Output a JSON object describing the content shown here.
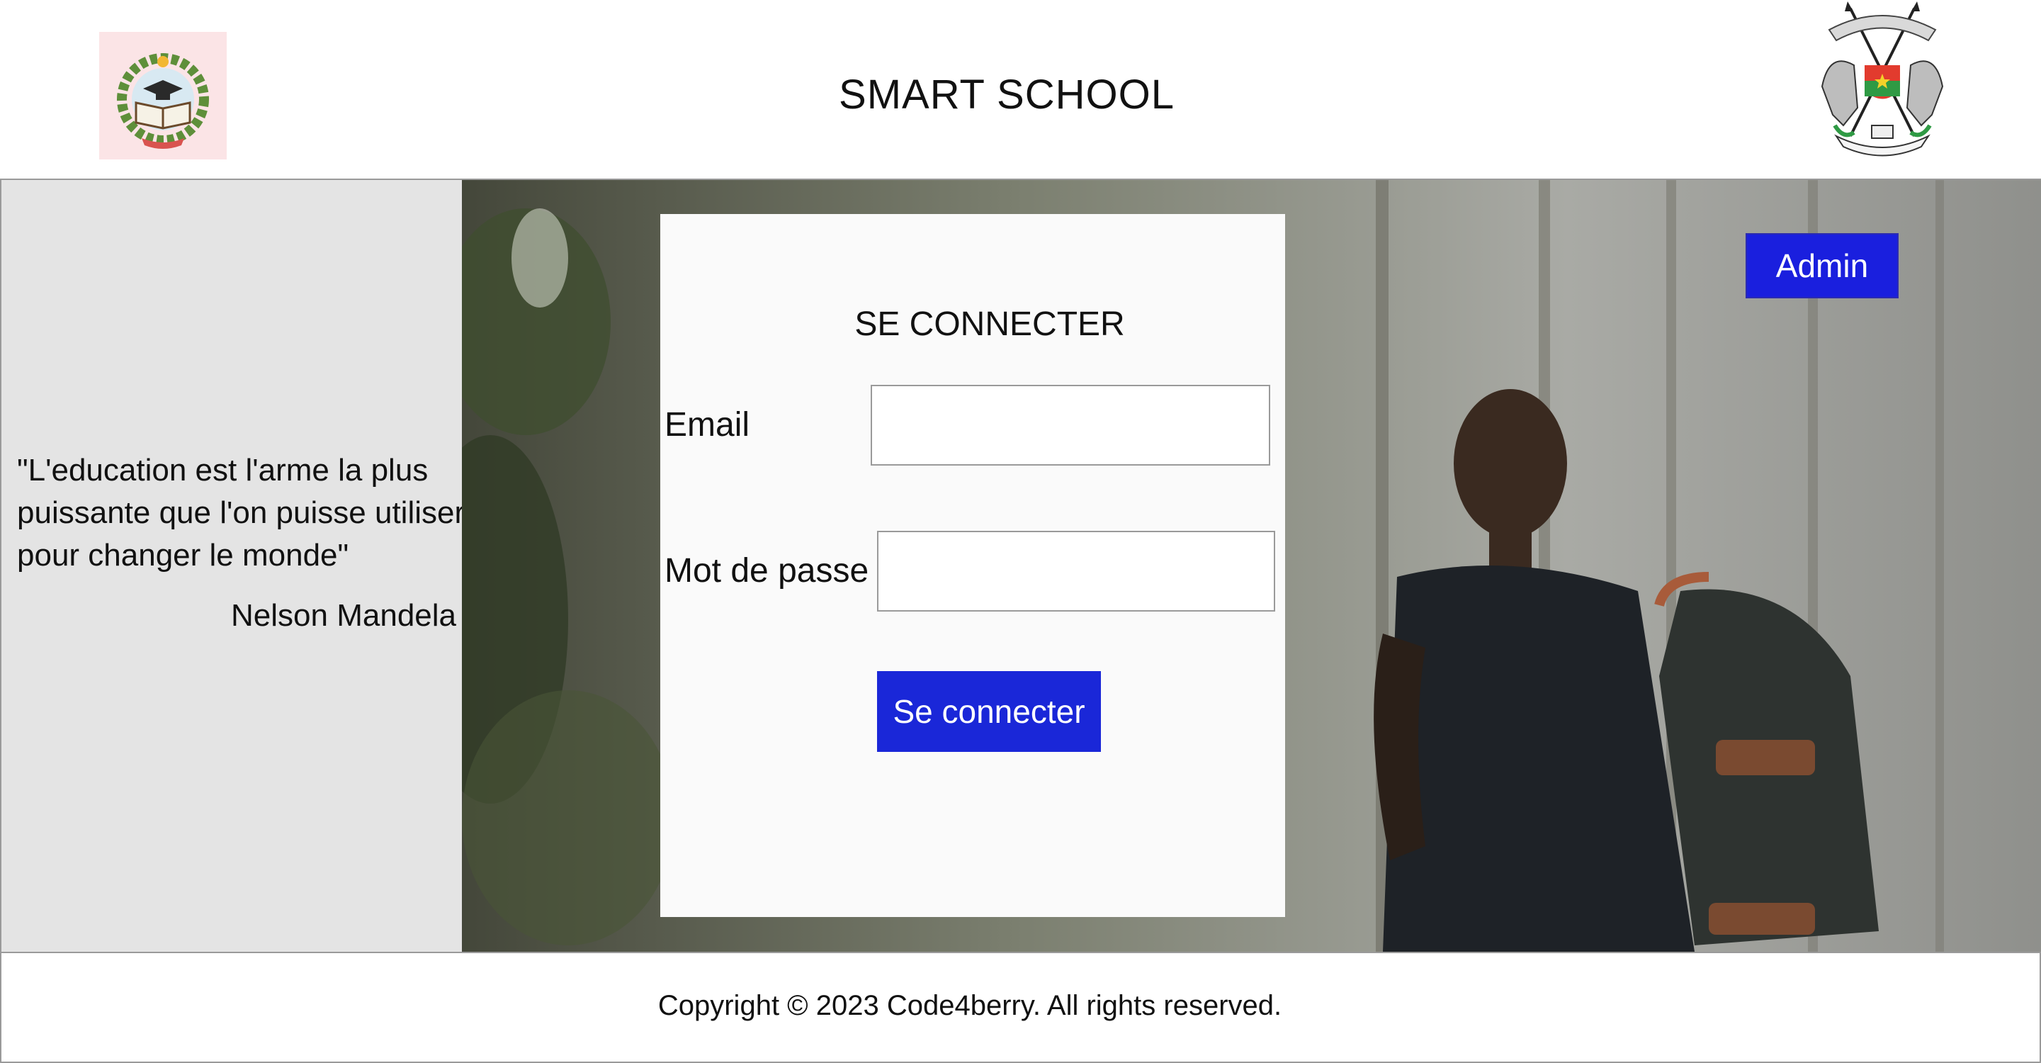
{
  "header": {
    "title": "SMART SCHOOL",
    "left_logo": "school-emblem-logo",
    "right_logo": "coat-of-arms-logo"
  },
  "quote": {
    "text": "\"L'education est l'arme la plus puissante que l'on puisse utiliser pour changer le monde\"",
    "author": "Nelson Mandela"
  },
  "login": {
    "title": "SE CONNECTER",
    "email_label": "Email",
    "email_value": "",
    "password_label": "Mot de passe",
    "password_value": "",
    "submit_label": "Se connecter"
  },
  "admin_button": "Admin",
  "footer": {
    "copyright": "Copyright © 2023 Code4berry. All rights reserved."
  },
  "colors": {
    "button_blue": "#1a27d8",
    "quote_panel_bg": "#e4e4e4",
    "card_bg": "#fafafa"
  }
}
